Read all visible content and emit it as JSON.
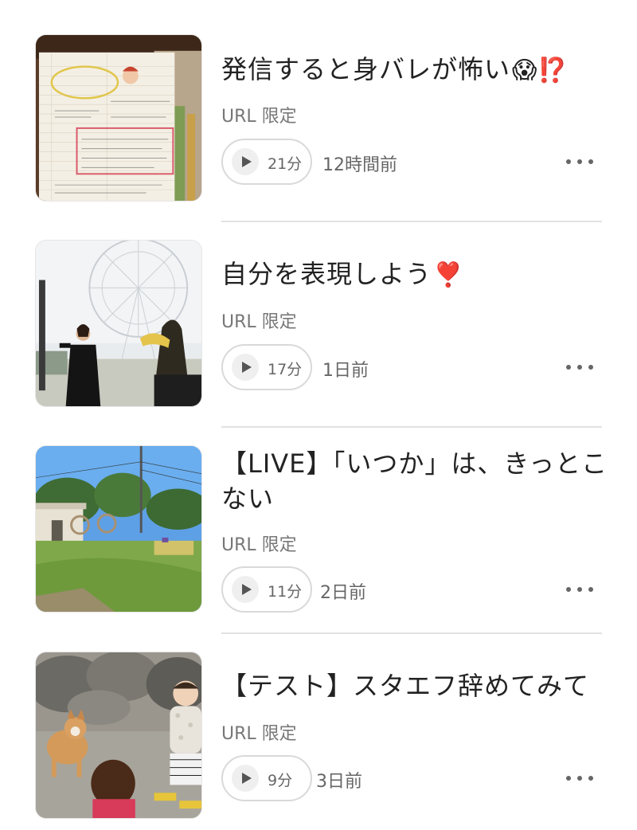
{
  "episodes": [
    {
      "title": "発信すると身バレが怖い",
      "title_emoji": "😱⁉️",
      "visibility": "URL 限定",
      "duration": "21分",
      "time_ago": "12時間前",
      "thumbnail": "journal-notebook-photo"
    },
    {
      "title": "自分を表現しよう",
      "title_emoji": "❣️",
      "visibility": "URL 限定",
      "duration": "17分",
      "time_ago": "1日前",
      "thumbnail": "ferris-wheel-woman-photo"
    },
    {
      "title": "【LIVE】「いつか」は、きっとこない",
      "title_emoji": "",
      "visibility": "URL 限定",
      "duration": "11分",
      "time_ago": "2日前",
      "thumbnail": "park-playground-photo"
    },
    {
      "title": "【テスト】スタエフ辞めてみて",
      "title_emoji": "",
      "visibility": "URL 限定",
      "duration": "9分",
      "time_ago": "3日前",
      "thumbnail": "dog-children-photo"
    }
  ],
  "icons": {
    "play": "play-icon",
    "more": "more-icon"
  }
}
